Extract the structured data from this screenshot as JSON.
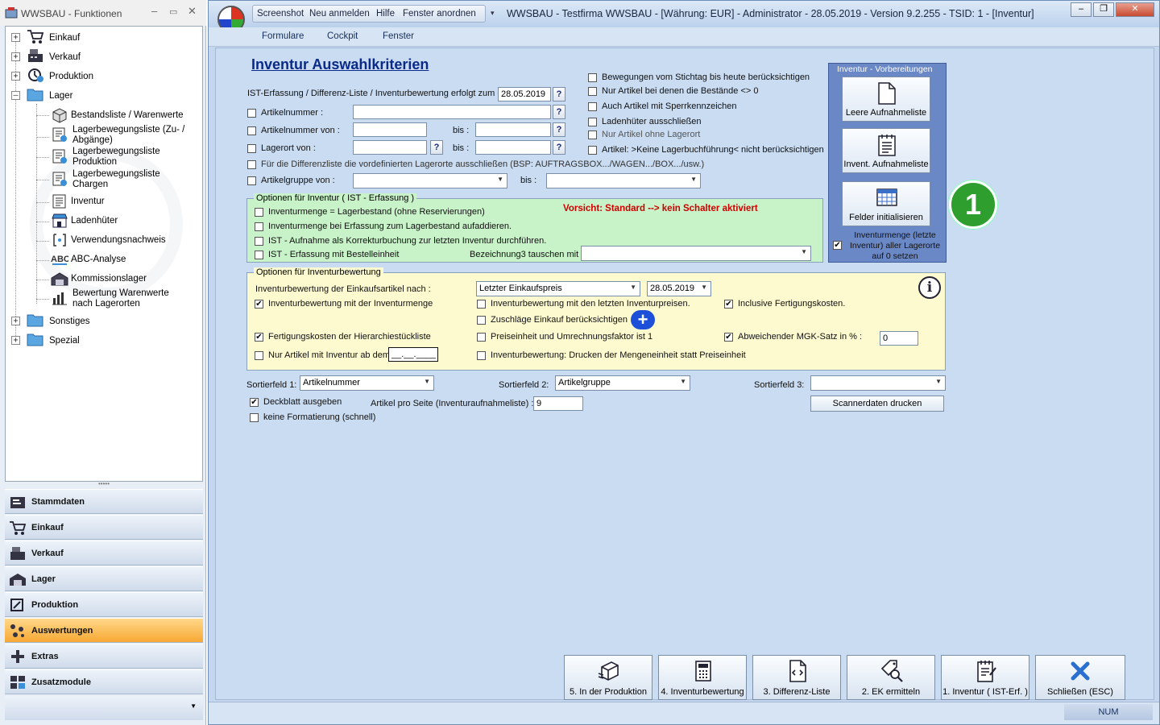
{
  "left_panel": {
    "title": "WWSBAU - Funktionen",
    "tree": [
      {
        "label": "Einkauf",
        "icon": "cart-icon"
      },
      {
        "label": "Verkauf",
        "icon": "register-icon"
      },
      {
        "label": "Produktion",
        "icon": "production-icon"
      },
      {
        "label": "Lager",
        "icon": "folder-open-icon"
      },
      {
        "label": "Bestandsliste / Warenwerte",
        "icon": "box-icon"
      },
      {
        "label": "Lagerbewegungsliste (Zu- / Abgänge)",
        "icon": "stock-move-icon"
      },
      {
        "label": "Lagerbewegungsliste Produktion",
        "icon": "stock-move-icon"
      },
      {
        "label": "Lagerbewegungsliste Chargen",
        "icon": "stock-move-icon"
      },
      {
        "label": "Inventur",
        "icon": "inventory-icon"
      },
      {
        "label": "Ladenhüter",
        "icon": "shop-icon"
      },
      {
        "label": "Verwendungsnachweis",
        "icon": "usage-icon"
      },
      {
        "label": "ABC-Analyse",
        "icon": "abc-icon"
      },
      {
        "label": "Kommissionslager",
        "icon": "warehouse-icon"
      },
      {
        "label": "Bewertung Warenwerte nach Lagerorten",
        "icon": "chart-icon"
      },
      {
        "label": "Sonstiges",
        "icon": "folder-icon"
      },
      {
        "label": "Spezial",
        "icon": "folder-icon"
      }
    ],
    "nav": [
      {
        "label": "Stammdaten"
      },
      {
        "label": "Einkauf"
      },
      {
        "label": "Verkauf"
      },
      {
        "label": "Lager"
      },
      {
        "label": "Produktion"
      },
      {
        "label": "Auswertungen"
      },
      {
        "label": "Extras"
      },
      {
        "label": "Zusatzmodule"
      }
    ]
  },
  "window": {
    "quick_access": [
      "Screenshot",
      "Neu anmelden",
      "Hilfe",
      "Fenster anordnen"
    ],
    "title": "WWSBAU - Testfirma WWSBAU - [Währung: EUR] - Administrator - 28.05.2019 - Version 9.2.255 - TSID: 1 - [Inventur]",
    "menu": [
      "Formulare",
      "Cockpit",
      "Fenster"
    ],
    "status_num": "NUM"
  },
  "form": {
    "title": "Inventur Auswahlkriterien",
    "ist_label": "IST-Erfassung / Differenz-Liste / Inventurbewertung erfolgt zum",
    "ist_date": "28.05.2019",
    "artikelnummer": "Artikelnummer :",
    "artikelnummer_von": "Artikelnummer von :",
    "lagerort_von": "Lagerort von :",
    "bis": "bis :",
    "differenz_exclude": "Für die Differenzliste die vordefinierten Lagerorte ausschließen (BSP: AUFTRAGSBOX.../WAGEN.../BOX.../usw.)",
    "artikelgruppe_von": "Artikelgruppe von :",
    "right_options": [
      "Bewegungen vom Stichtag bis heute berücksichtigen",
      "Nur Artikel bei denen die Bestände <> 0",
      "Auch Artikel mit Sperrkennzeichen",
      "Ladenhüter ausschließen",
      "Nur Artikel ohne Lagerort",
      "Artikel: >Keine Lagerbuchführung< nicht berücksichtigen"
    ],
    "ist_group": {
      "title": "Optionen für Inventur ( IST - Erfassung )",
      "warning": "Vorsicht: Standard --> kein Schalter aktiviert",
      "options": [
        "Inventurmenge = Lagerbestand (ohne Reservierungen)",
        "Inventurmenge bei Erfassung zum Lagerbestand aufaddieren.",
        "IST - Aufnahme als Korrekturbuchung zur letzten Inventur durchführen.",
        "IST - Erfassung mit Bestelleinheit"
      ],
      "bez3_label": "Bezeichnung3 tauschen mit"
    },
    "bew_group": {
      "title": "Optionen für Inventurbewertung",
      "einkauf_label": "Inventurbewertung der Einkaufsartikel nach :",
      "einkauf_value": "Letzter Einkaufspreis",
      "date_value": "28.05.2019",
      "opt_menge": "Inventurbewertung mit der Inventurmenge",
      "opt_letzten": "Inventurbewertung mit den letzten Inventurpreisen.",
      "opt_fertigung": "Inclusive Fertigungskosten.",
      "opt_zuschlaege": "Zuschläge Einkauf berücksichtigen",
      "opt_hierarchie": "Fertigungskosten der Hierarchiestückliste",
      "opt_preiseinheit": "Preiseinheit und Umrechnungsfaktor ist 1",
      "opt_mgk": "Abweichender MGK-Satz in % :",
      "mgk_value": "0",
      "opt_nurartikel": "Nur Artikel mit Inventur ab dem:",
      "nurartikel_value": "__.__.____",
      "opt_drucken": "Inventurbewertung: Drucken der Mengeneinheit statt Preiseinheit"
    },
    "vorbereitungen": {
      "title": "Inventur - Vorbereitungen",
      "btn1": "Leere Aufnahmeliste",
      "btn2": "Invent. Aufnahmeliste",
      "btn3": "Felder initialisieren",
      "reset_label": "Inventurmenge (letzte Inventur) aller Lagerorte auf 0 setzen"
    },
    "badge": "1",
    "sort1_label": "Sortierfeld 1:",
    "sort1_value": "Artikelnummer",
    "sort2_label": "Sortierfeld 2:",
    "sort2_value": "Artikelgruppe",
    "sort3_label": "Sortierfeld 3:",
    "sort3_value": "",
    "scanner_btn": "Scannerdaten drucken",
    "deckblatt": "Deckblatt ausgeben",
    "artikel_pro_seite": "Artikel pro Seite (Inventuraufnahmeliste) :",
    "artikel_pro_seite_value": "9",
    "keine_format": "keine Formatierung (schnell)"
  },
  "bottom_buttons": [
    {
      "label": "5. In der Produktion",
      "icon": "production-icon"
    },
    {
      "label": "4. Inventurbewertung",
      "icon": "calculator-icon"
    },
    {
      "label": "3. Differenz-Liste",
      "icon": "document-code-icon"
    },
    {
      "label": "2. EK ermitteln",
      "icon": "price-tag-search-icon"
    },
    {
      "label": "1. Inventur ( IST-Erf. )",
      "icon": "notepad-icon"
    },
    {
      "label": "Schließen (ESC)",
      "icon": "close-x-icon"
    }
  ],
  "colors": {
    "accent": "#0a2a8a",
    "green_group": "#c8f2c8",
    "yellow_group": "#fdfad0",
    "warning": "#d00000",
    "badge": "#2e9e2e",
    "active_nav": "#f7a833",
    "vorbereitung_panel": "#6a88c6"
  }
}
